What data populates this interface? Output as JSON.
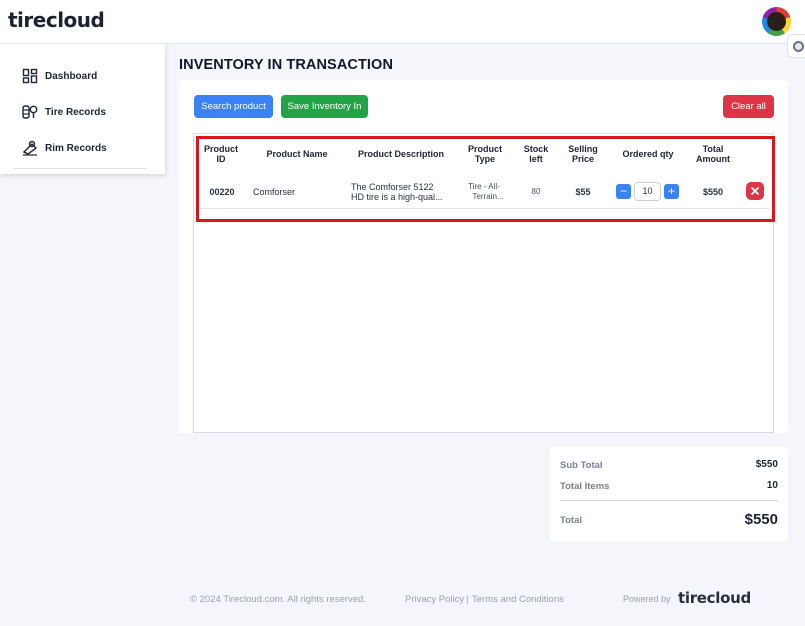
{
  "app": {
    "logo_text": "tirecloud"
  },
  "sidebar": {
    "items": [
      {
        "label": "Dashboard",
        "icon": "dashboard-icon"
      },
      {
        "label": "Tire Records",
        "icon": "tire-records-icon"
      },
      {
        "label": "Rim Records",
        "icon": "rim-records-icon"
      }
    ]
  },
  "page": {
    "title": "INVENTORY IN TRANSACTION"
  },
  "toolbar": {
    "search_label": "Search product",
    "save_label": "Save Inventory In",
    "clear_label": "Clear all"
  },
  "table": {
    "headers": {
      "product_id": "Product ID",
      "product_name": "Product Name",
      "product_description": "Product Description",
      "product_type": "Product Type",
      "stock_left": "Stock left",
      "selling_price": "Selling Price",
      "ordered_qty": "Ordered qty",
      "total_amount": "Total Amount"
    },
    "rows": [
      {
        "product_id": "00220",
        "product_name": "Comforser",
        "description_line1": "The Comforser 5122",
        "description_line2": "HD tire is a high-qual...",
        "type_line1": "Tire - All-",
        "type_line2": "Terrain...",
        "stock_left": "80",
        "selling_price": "$55",
        "ordered_qty": "10",
        "total_amount": "$550"
      }
    ]
  },
  "summary": {
    "sub_total_label": "Sub Total",
    "sub_total_value": "$550",
    "total_items_label": "Total Items",
    "total_items_value": "10",
    "total_label": "Total",
    "total_value": "$550"
  },
  "footer": {
    "copyright": "© 2024 Tirecloud.com. All rights reserved.",
    "privacy": "Privacy Policy",
    "separator": "|",
    "terms": "Terms and Conditions",
    "powered_by": "Powered by",
    "powered_logo": "tirecloud"
  },
  "colors": {
    "primary": "#3b82f6",
    "success": "#22a347",
    "danger": "#dc3545",
    "highlight": "#d8161b"
  }
}
